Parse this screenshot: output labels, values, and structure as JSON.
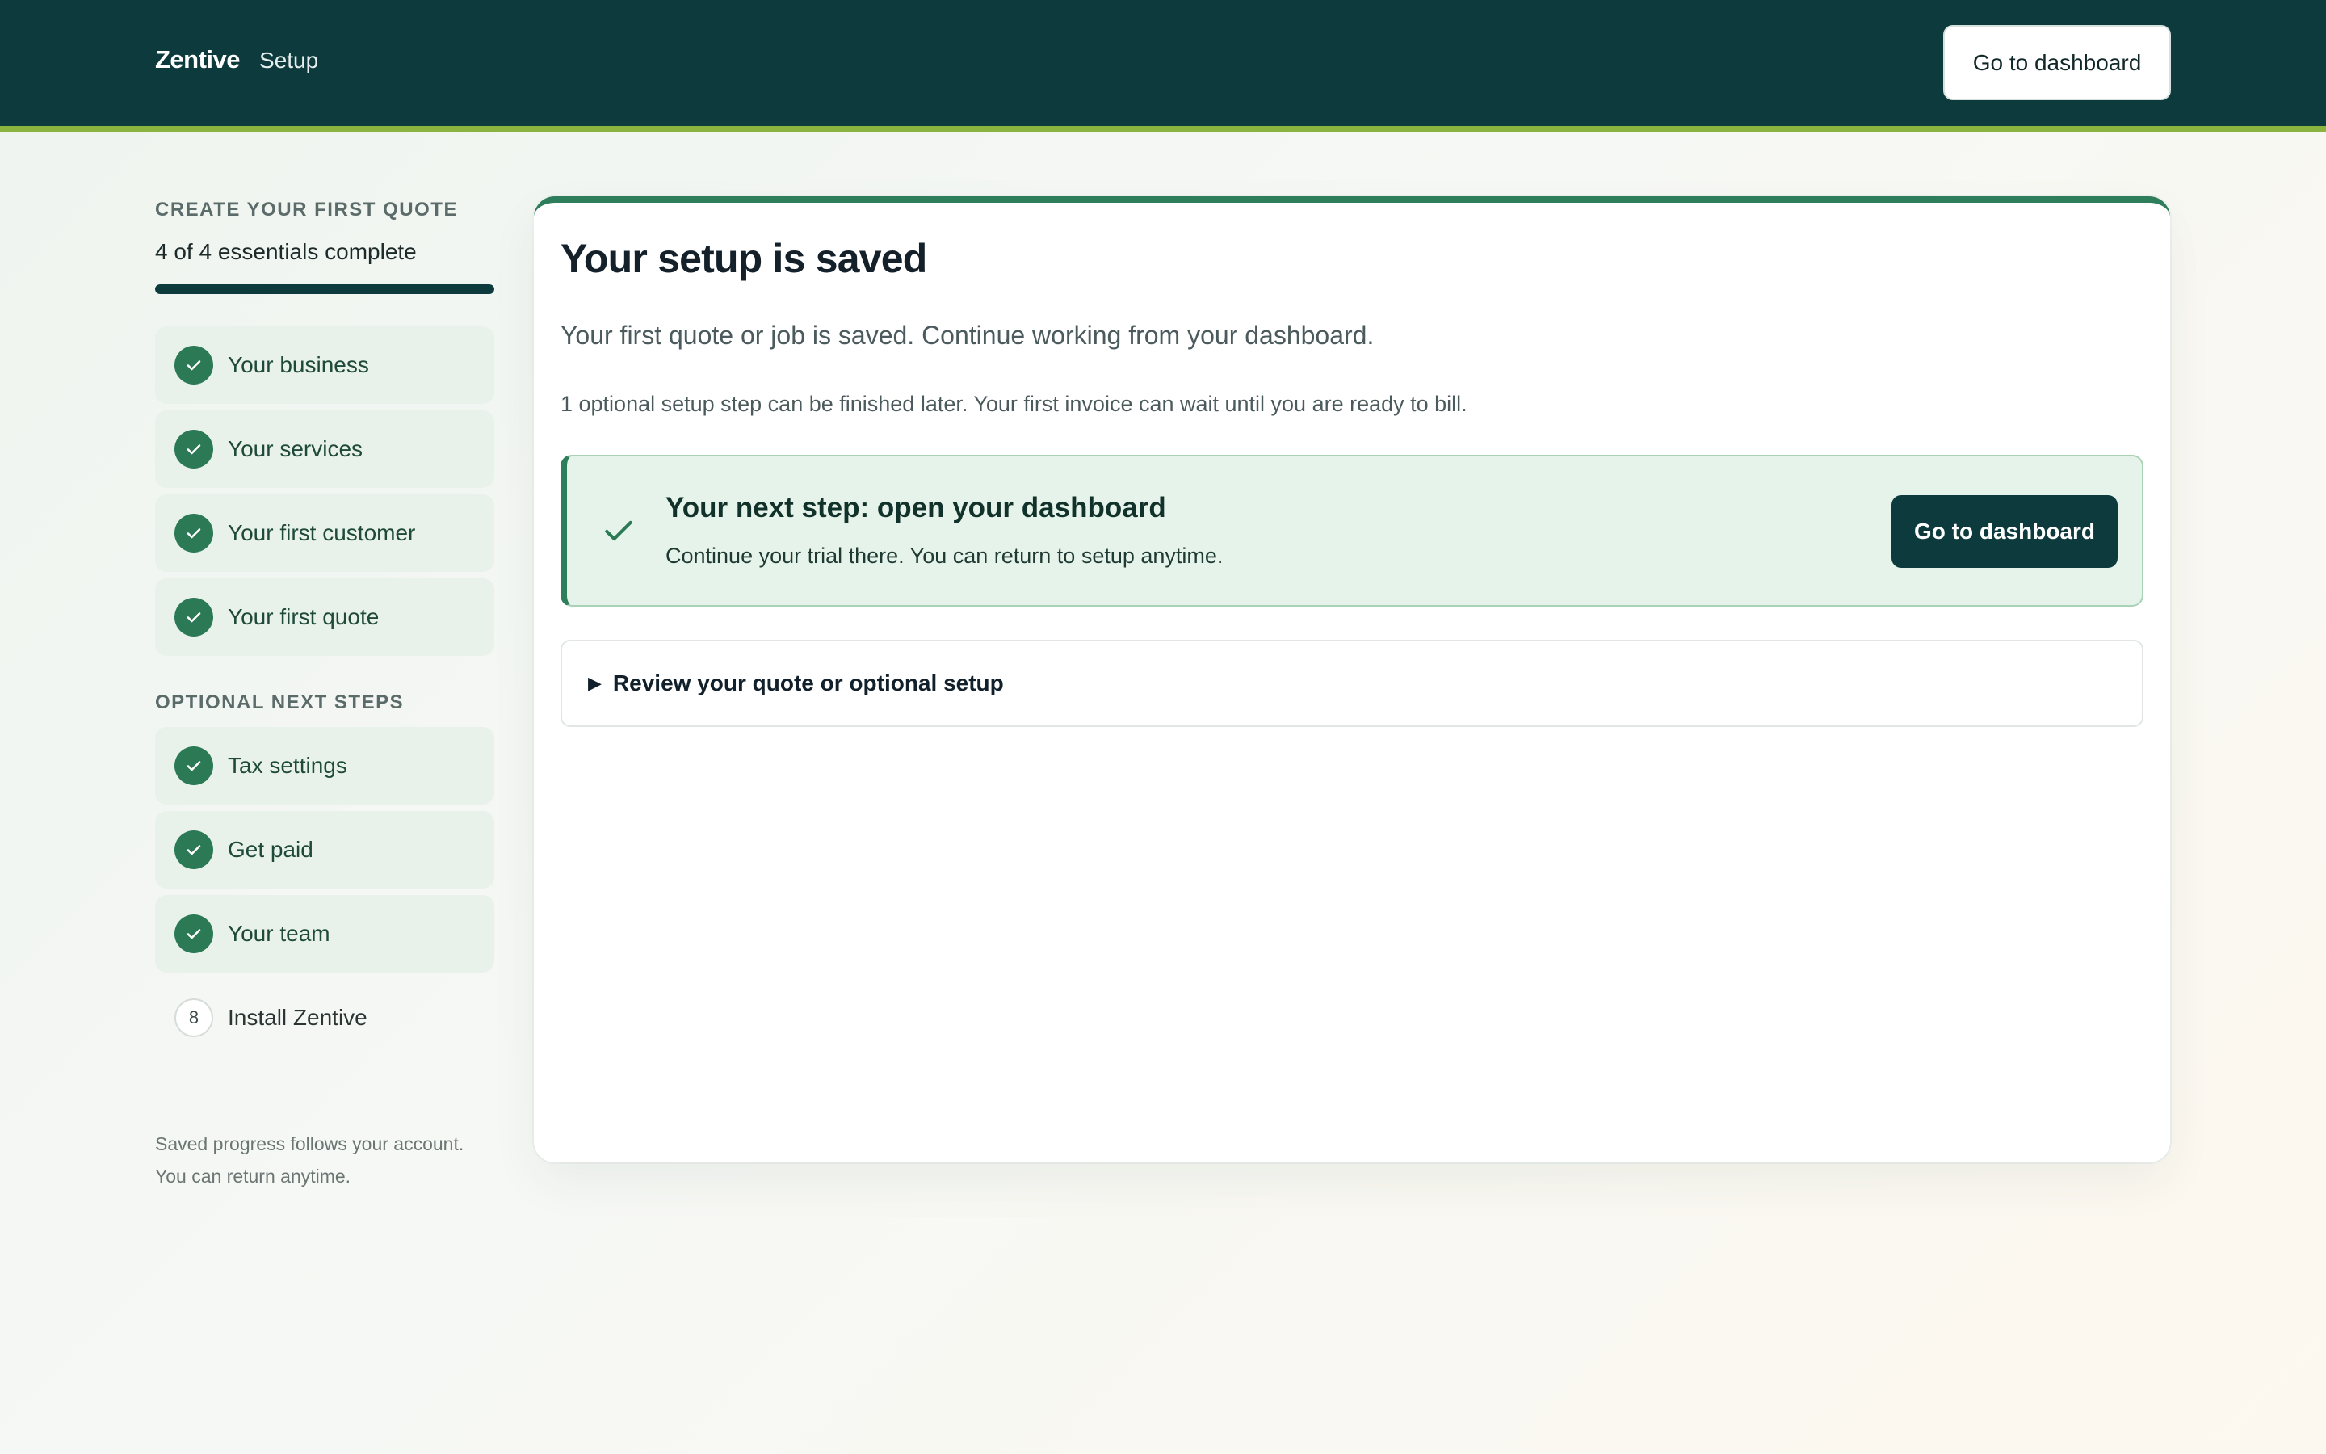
{
  "header": {
    "brand": "Zentive",
    "section": "Setup",
    "dashboard_button": "Go to dashboard"
  },
  "sidebar": {
    "heading": "CREATE YOUR FIRST QUOTE",
    "progress_text": "4 of 4 essentials complete",
    "progress_fraction": 1.0,
    "essentials": [
      {
        "label": "Your business",
        "status": "complete"
      },
      {
        "label": "Your services",
        "status": "complete"
      },
      {
        "label": "Your first customer",
        "status": "complete"
      },
      {
        "label": "Your first quote",
        "status": "complete"
      }
    ],
    "optional_heading": "OPTIONAL NEXT STEPS",
    "optional": [
      {
        "label": "Tax settings",
        "status": "complete"
      },
      {
        "label": "Get paid",
        "status": "complete"
      },
      {
        "label": "Your team",
        "status": "complete"
      },
      {
        "label": "Install Zentive",
        "status": "pending",
        "number": "8"
      }
    ],
    "note_line1": "Saved progress follows your account.",
    "note_line2": "You can return anytime."
  },
  "main": {
    "title": "Your setup is saved",
    "lead": "Your first quote or job is saved. Continue working from your dashboard.",
    "note": "1 optional setup step can be finished later. Your first invoice can wait until you are ready to bill.",
    "next_step": {
      "title": "Your next step: open your dashboard",
      "subtitle": "Continue your trial there. You can return to setup anytime.",
      "button": "Go to dashboard"
    },
    "review": {
      "caret": "▶",
      "label": "Review your quote or optional setup"
    }
  },
  "colors": {
    "header_bg": "#0d3b3d",
    "accent_bar": "#8ab43f",
    "success": "#2b7a55",
    "primary_button": "#0d3b3d"
  }
}
